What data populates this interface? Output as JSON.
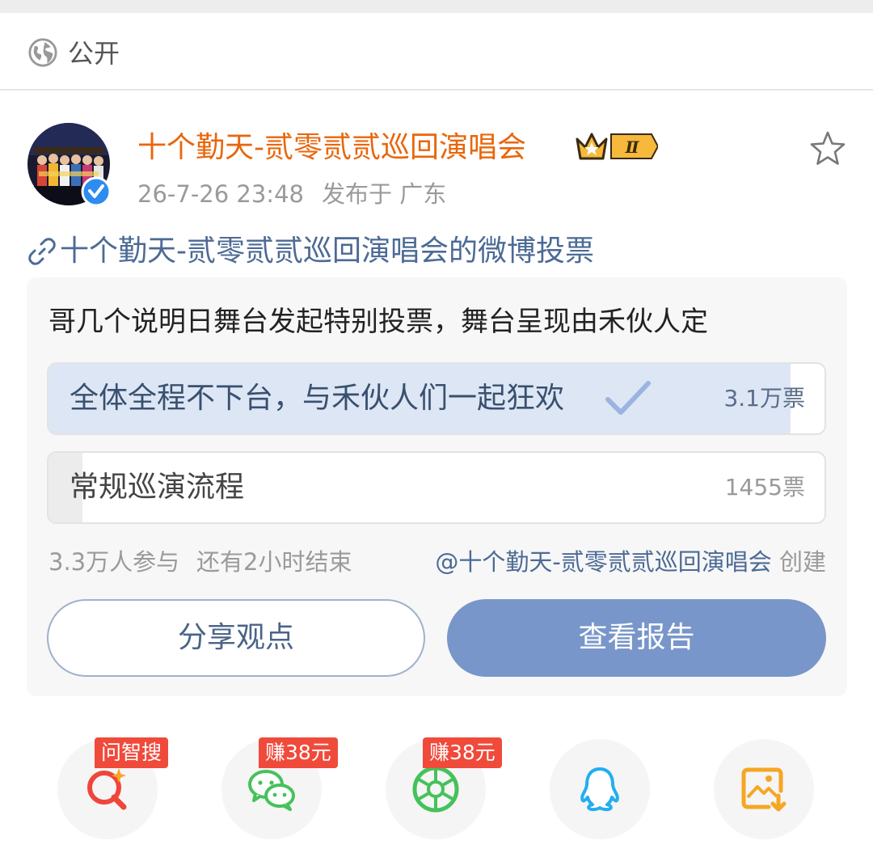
{
  "visibility": {
    "label": "公开",
    "icon": "globe-icon"
  },
  "post": {
    "author": "十个勤天-贰零贰贰巡回演唱会",
    "badge_level": "Ⅱ",
    "time": "26-7-26 23:48",
    "location": "发布于 广东"
  },
  "poll_link": {
    "text": "十个勤天-贰零贰贰巡回演唱会的微博投票"
  },
  "poll": {
    "question": "哥几个说明日舞台发起特别投票，舞台呈现由禾伙人定",
    "options": [
      {
        "label": "全体全程不下台，与禾伙人们一起狂欢",
        "votes": "3.1万票",
        "share": 0.956,
        "selected": true
      },
      {
        "label": "常规巡演流程",
        "votes": "1455票",
        "share": 0.044,
        "selected": false
      }
    ],
    "participants": "3.3万人参与",
    "time_left": "还有2小时结束",
    "creator": "@十个勤天-贰零贰贰巡回演唱会",
    "creator_suffix": " 创建",
    "share_button": "分享观点",
    "report_button": "查看报告"
  },
  "share_bar": [
    {
      "name": "zhisou",
      "icon": "ai-search-icon",
      "tag": "问智搜",
      "color": "#f0453a"
    },
    {
      "name": "wechat",
      "icon": "wechat-icon",
      "tag": "赚38元",
      "color": "#45c25a"
    },
    {
      "name": "moments",
      "icon": "wechat-moments-icon",
      "tag": "赚38元",
      "color": "#45c25a"
    },
    {
      "name": "qq",
      "icon": "qq-icon",
      "tag": "",
      "color": "#22aef0"
    },
    {
      "name": "save-image",
      "icon": "save-image-icon",
      "tag": "",
      "color": "#f5a623"
    }
  ],
  "colors": {
    "author": "#e9660b",
    "link": "#4c6a95",
    "report_button": "#7896c9",
    "selected_fill": "#dde6f4",
    "tag": "#f04a3b"
  }
}
